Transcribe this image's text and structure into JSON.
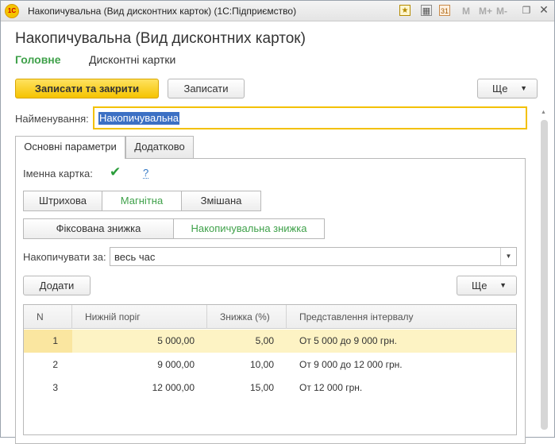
{
  "window": {
    "title": "Накопичувальна (Вид дисконтних карток)  (1С:Підприємство)",
    "logo_text": "1С",
    "toolbar_m": "M",
    "toolbar_mplus": "M+",
    "toolbar_mminus": "M-"
  },
  "form": {
    "title": "Накопичувальна (Вид дисконтних карток)",
    "nav": {
      "main": "Головне",
      "cards": "Дисконтні картки"
    }
  },
  "toolbar": {
    "save_close": "Записати та закрити",
    "save": "Записати",
    "more": "Ще"
  },
  "name_field": {
    "label": "Найменування:",
    "value": "Накопичувальна"
  },
  "tabs": [
    {
      "label": "Основні параметри"
    },
    {
      "label": "Додатково"
    }
  ],
  "named_card": {
    "label": "Іменна картка:",
    "checked": true,
    "help": "?"
  },
  "card_type": {
    "options": [
      "Штрихова",
      "Магнітна",
      "Змішана"
    ],
    "selected": "Магнітна"
  },
  "discount_type": {
    "options": [
      "Фіксована знижка",
      "Накопичувальна знижка"
    ],
    "selected": "Накопичувальна знижка"
  },
  "accumulate": {
    "label": "Накопичувати за:",
    "value": "весь час"
  },
  "table_toolbar": {
    "add": "Додати",
    "more": "Ще"
  },
  "table": {
    "columns": [
      "N",
      "Нижній поріг",
      "Знижка (%)",
      "Представлення інтервалу"
    ],
    "rows": [
      {
        "n": "1",
        "threshold": "5 000,00",
        "discount": "5,00",
        "interval": "От 5 000 до 9 000 грн."
      },
      {
        "n": "2",
        "threshold": "9 000,00",
        "discount": "10,00",
        "interval": "От 9 000 до 12 000 грн."
      },
      {
        "n": "3",
        "threshold": "12 000,00",
        "discount": "15,00",
        "interval": "От 12 000 грн."
      }
    ]
  },
  "colors": {
    "accent_green": "#3fa14a",
    "primary_yellow": "#f5c300",
    "selection_blue": "#3c70c4"
  }
}
